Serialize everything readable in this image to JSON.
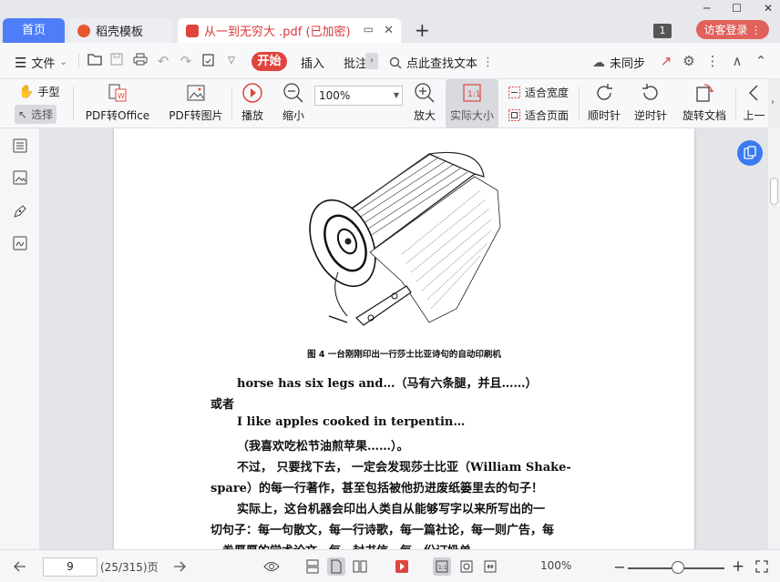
{
  "tabs": {
    "home": "首页",
    "template": "稻壳模板",
    "document": "从一到无穷大 .pdf (已加密)",
    "new_tab": "+"
  },
  "titlebar": {
    "badge": "1",
    "login": "访客登录"
  },
  "menubar": {
    "file": "文件",
    "start": "开始",
    "insert": "插入",
    "annotate": "批注",
    "search": "点此查找文本",
    "sync": "未同步"
  },
  "ribbon": {
    "hand": "手型",
    "select": "选择",
    "pdf_to_office": "PDF转Office",
    "pdf_to_image": "PDF转图片",
    "play": "播放",
    "zoom_out": "缩小",
    "zoom_value": "100%",
    "zoom_in": "放大",
    "actual_size": "实际大小",
    "fit_width": "适合宽度",
    "fit_page": "适合页面",
    "rotate_cw": "顺时针",
    "rotate_ccw": "逆时针",
    "rotate_doc": "旋转文档",
    "prev": "上一"
  },
  "document": {
    "caption": "图 4    一台刚刚印出一行莎士比亚诗句的自动印刷机",
    "lines": [
      "horse has six legs and…（马有六条腿，并且……）",
      "或者",
      "I like apples cooked in terpentin…",
      "（我喜欢吃松节油煎苹果……）。",
      "不过，  只要找下去，  一定会发现莎士比亚（William Shake-",
      "spare）的每一行著作，甚至包括被他扔进废纸篓里去的句子！",
      "实际上，这台机器会印出人类自从能够写字以来所写出的一",
      "切句子：每一句散文，每一行诗歌，每一篇社论，每一则广告，每",
      "一卷厚厚的学术论文，每一封书信，每一份订奶单……"
    ]
  },
  "statusbar": {
    "page_value": "9",
    "page_info": "(25/315)页",
    "zoom": "100%"
  }
}
